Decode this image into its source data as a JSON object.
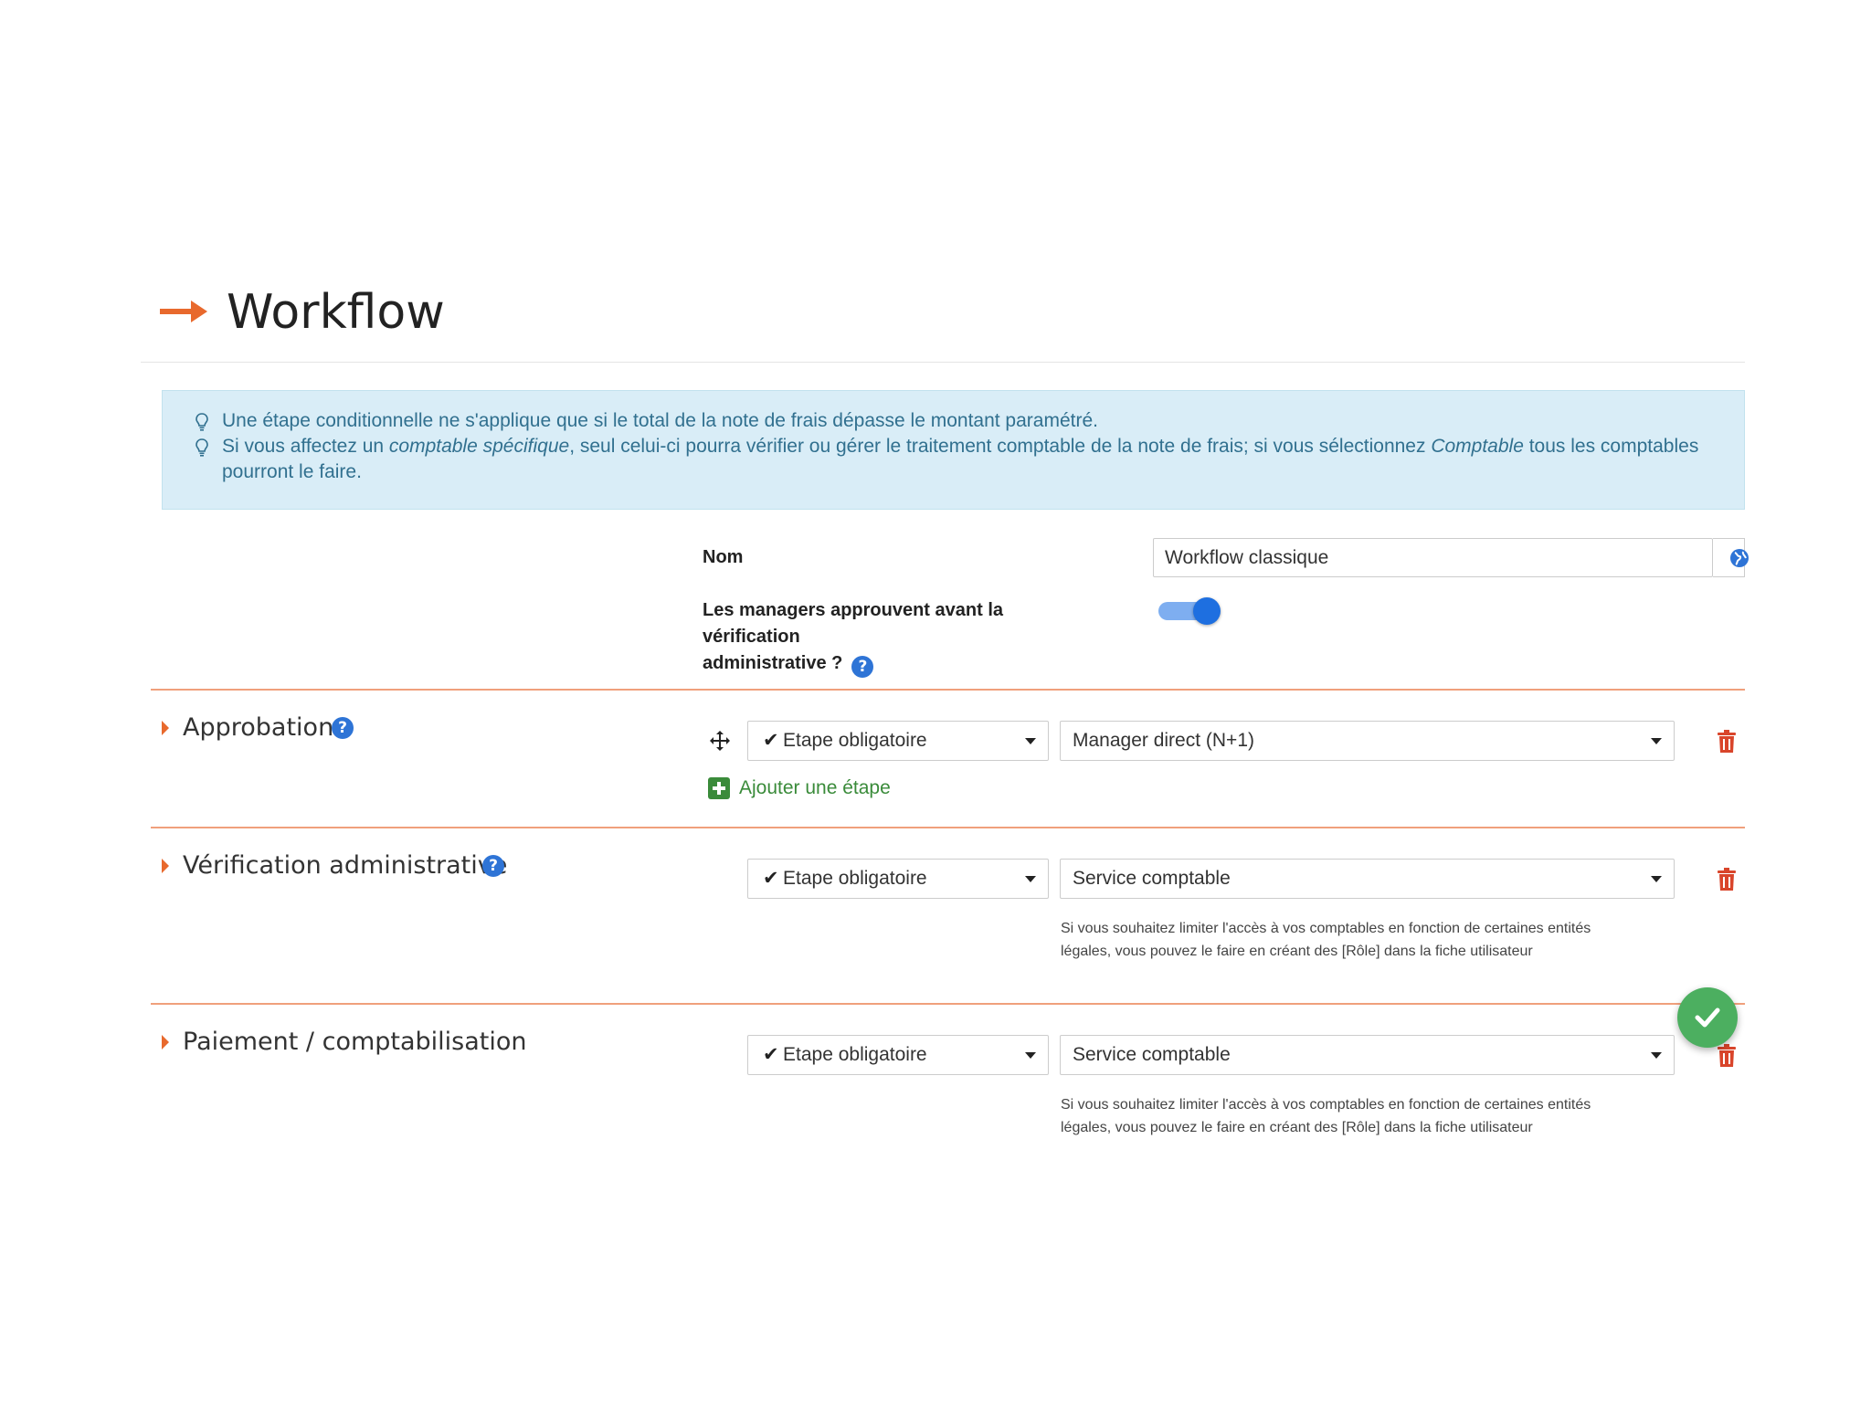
{
  "header": {
    "title": "Workflow"
  },
  "info": {
    "line1": "Une étape conditionnelle ne s'applique que si le total de la note de frais dépasse le montant paramétré.",
    "line2_part1": "Si vous affectez un ",
    "line2_em1": "comptable spécifique",
    "line2_part2": ", seul celui-ci pourra vérifier ou gérer le traitement comptable de la note de frais; si vous sélectionnez ",
    "line2_em2": "Comptable",
    "line2_part3": " tous les comptables pourront le faire."
  },
  "form": {
    "name_label": "Nom",
    "name_value": "Workflow classique",
    "managers_label_line1": "Les managers approuvent avant la vérification",
    "managers_label_line2": "administrative ?",
    "managers_toggle_on": true
  },
  "help_glyph": "?",
  "sections": [
    {
      "title": "Approbation",
      "step_type": "Etape obligatoire",
      "assignee": "Manager direct (N+1)",
      "add_step_label": "Ajouter une étape"
    },
    {
      "title": "Vérification administrative",
      "step_type": "Etape obligatoire",
      "assignee": "Service comptable",
      "help_line1": "Si vous souhaitez limiter l'accès à vos comptables en fonction de certaines entités",
      "help_line2": "légales, vous pouvez le faire en créant des [Rôle] dans la fiche utilisateur"
    },
    {
      "title": "Paiement / comptabilisation",
      "step_type": "Etape obligatoire",
      "assignee": "Service comptable",
      "help_line1": "Si vous souhaitez limiter l'accès à vos comptables en fonction de certaines entités",
      "help_line2": "légales, vous pouvez le faire en créant des [Rôle] dans la fiche utilisateur"
    }
  ],
  "colors": {
    "accent_orange": "#e8692d",
    "info_bg": "#d9edf7",
    "info_text": "#31708f",
    "toggle_on": "#1e6fe0",
    "add_green": "#3a8b3a",
    "trash_red": "#d9452b",
    "fab_green": "#4caf60"
  },
  "icons": [
    "arrow-right-icon",
    "lightbulb-icon",
    "globe-icon",
    "help-icon",
    "caret-right-icon",
    "move-icon",
    "check-icon",
    "chevron-down-icon",
    "plus-square-icon",
    "trash-icon",
    "check-circle-icon"
  ]
}
